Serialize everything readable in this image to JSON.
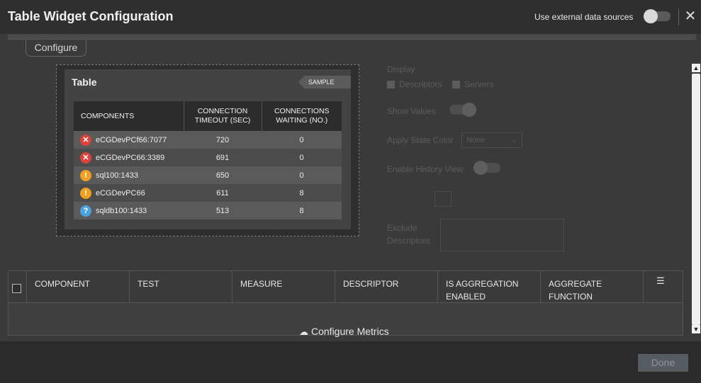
{
  "header": {
    "title": "Table Widget Configuration",
    "external_label": "Use external data sources"
  },
  "tabs": [
    {
      "label": "Configure"
    }
  ],
  "preview": {
    "title": "Table",
    "badge": "SAMPLE DATA",
    "columns": [
      "COMPONENTS",
      "CONNECTION TIMEOUT (SEC)",
      "CONNECTIONS WAITING (NO.)"
    ],
    "rows": [
      {
        "status": "critical",
        "icon": "x-icon",
        "glyph": "✕",
        "component": "eCGDevPCf66:7077",
        "timeout": "720",
        "waiting": "0"
      },
      {
        "status": "critical",
        "icon": "x-icon",
        "glyph": "✕",
        "component": "eCGDevPC66:3389",
        "timeout": "691",
        "waiting": "0"
      },
      {
        "status": "warning",
        "icon": "exclamation-icon",
        "glyph": "!",
        "component": "sql100:1433",
        "timeout": "650",
        "waiting": "0"
      },
      {
        "status": "warning",
        "icon": "exclamation-icon",
        "glyph": "!",
        "component": "eCGDevPC66",
        "timeout": "611",
        "waiting": "8"
      },
      {
        "status": "unknown",
        "icon": "question-icon",
        "glyph": "?",
        "component": "sqldb100:1433",
        "timeout": "513",
        "waiting": "8"
      }
    ]
  },
  "settings": {
    "display_label": "Display",
    "descriptors_label": "Descriptors",
    "servers_label": "Servers",
    "show_values_label": "Show Values",
    "apply_state_color_label": "Apply State Color",
    "state_color_value": "None",
    "enable_history_label": "Enable History View",
    "exclude_label_1": "Exclude",
    "exclude_label_2": "Descriptors"
  },
  "metrics": {
    "columns": [
      {
        "label": "COMPONENT"
      },
      {
        "label": "TEST"
      },
      {
        "label": "MEASURE"
      },
      {
        "label": "DESCRIPTOR"
      },
      {
        "label_1": "IS AGGREGATION",
        "label_2": "ENABLED"
      },
      {
        "label_1": "AGGREGATE",
        "label_2": "FUNCTION"
      }
    ],
    "configure_label": "Configure Metrics"
  },
  "footer": {
    "done_label": "Done"
  },
  "colors": {
    "critical": "#d9443a",
    "warning": "#f0a020",
    "unknown": "#4aa3df"
  }
}
